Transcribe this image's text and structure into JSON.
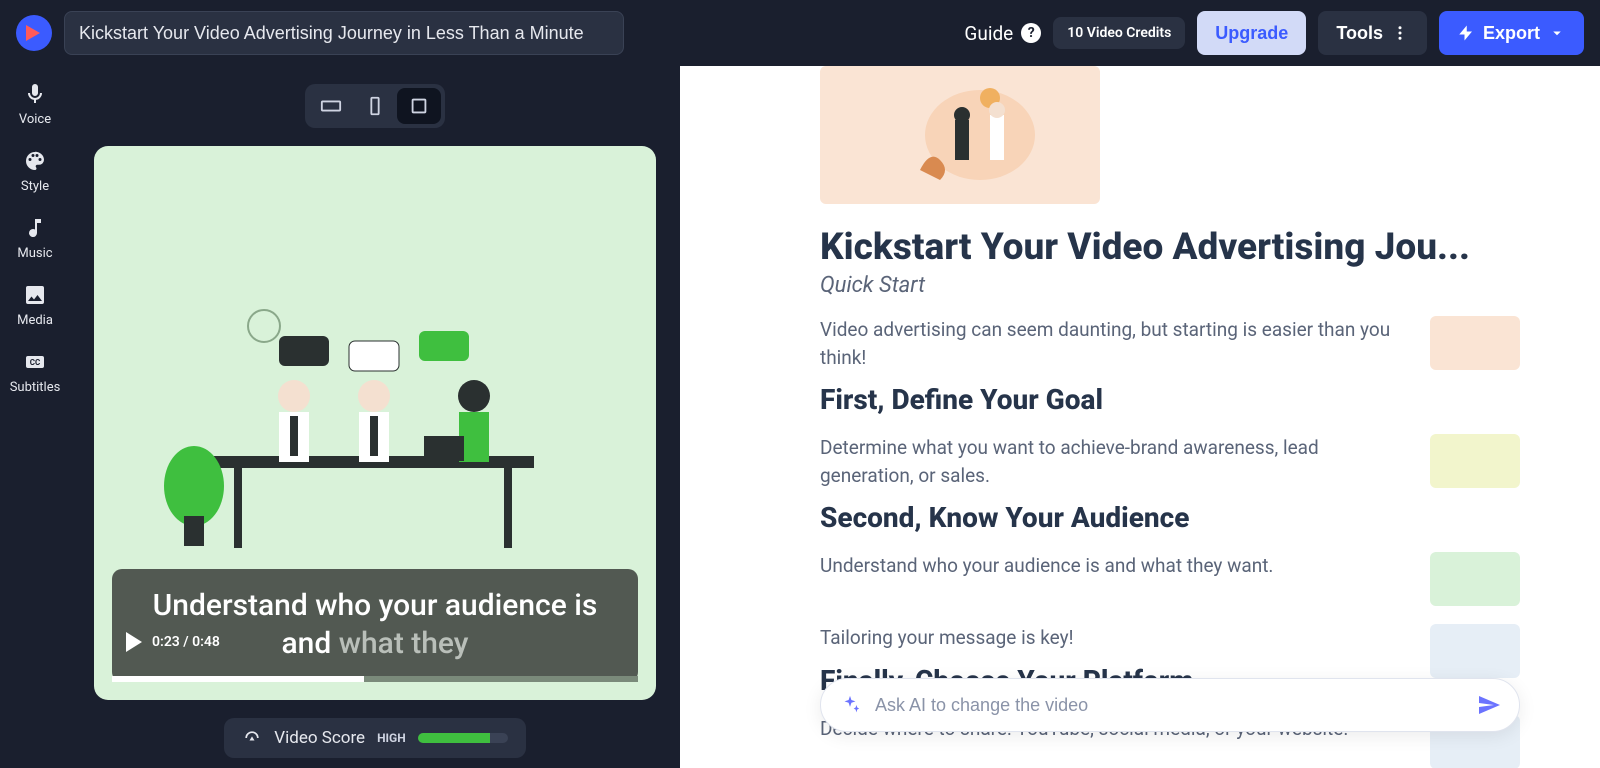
{
  "header": {
    "title_value": "Kickstart Your Video Advertising Journey in Less Than a Minute",
    "guide_label": "Guide",
    "credits_label": "10 Video Credits",
    "upgrade_label": "Upgrade",
    "tools_label": "Tools",
    "export_label": "Export"
  },
  "sidebar": {
    "items": [
      {
        "key": "voice",
        "label": "Voice"
      },
      {
        "key": "style",
        "label": "Style"
      },
      {
        "key": "music",
        "label": "Music"
      },
      {
        "key": "media",
        "label": "Media"
      },
      {
        "key": "subtitles",
        "label": "Subtitles"
      }
    ]
  },
  "preview": {
    "caption_full": "Understand who your audience is and",
    "caption_faded": "what they",
    "time_current": "0:23",
    "time_total": "0:48",
    "score_label": "Video Score",
    "score_badge": "HIGH"
  },
  "content": {
    "title": "Kickstart Your Video Advertising Jou...",
    "subtitle": "Quick Start",
    "sections": [
      {
        "body": "Video advertising can seem daunting, but starting is easier than you think!",
        "heading": "First, Define Your Goal"
      },
      {
        "body": "Determine what you want to achieve-brand awareness, lead generation, or sales.",
        "heading": "Second, Know Your Audience"
      },
      {
        "body": "Understand who your audience is and what they want.",
        "heading": ""
      },
      {
        "body": "Tailoring your message is key!",
        "heading": "Finally, Choose Your Platform"
      },
      {
        "body": "Decide where to share: YouTube, social media, or your website.",
        "heading": ""
      }
    ],
    "ai_placeholder": "Ask AI to change the video"
  }
}
